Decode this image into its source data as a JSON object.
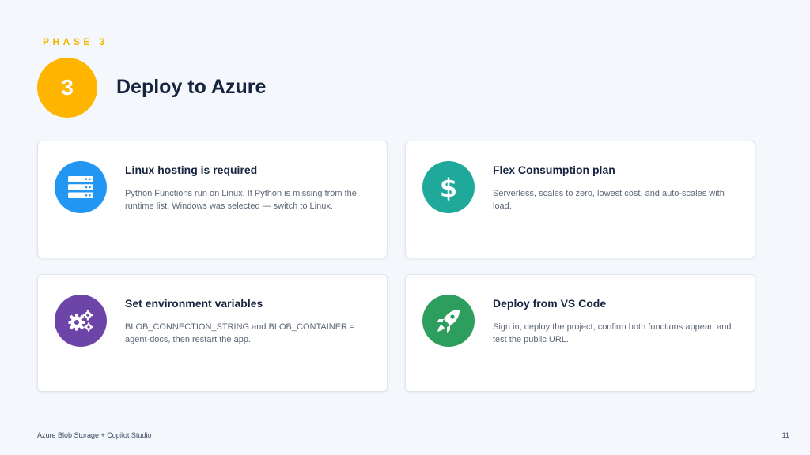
{
  "header": {
    "phase_label": "PHASE 3",
    "phase_number": "3",
    "title": "Deploy to Azure",
    "accent_color": "#ffb500"
  },
  "cards": [
    {
      "title": "Linux hosting is required",
      "description": "Python Functions run on Linux. If Python is missing from the runtime list, Windows was selected — switch to Linux.",
      "icon": "server-icon",
      "color": "#2196f3"
    },
    {
      "title": "Flex Consumption plan",
      "description": "Serverless, scales to zero, lowest cost, and auto-scales with load.",
      "icon": "dollar-icon",
      "color": "#1fa99a"
    },
    {
      "title": "Set environment variables",
      "description": "BLOB_CONNECTION_STRING and BLOB_CONTAINER = agent-docs, then restart the app.",
      "icon": "gears-icon",
      "color": "#6d45a8"
    },
    {
      "title": "Deploy from VS Code",
      "description": "Sign in, deploy the project, confirm both functions appear, and test the public URL.",
      "icon": "rocket-icon",
      "color": "#2e9e5e"
    }
  ],
  "footer": {
    "left": "Azure Blob Storage + Copilot Studio",
    "page_number": "11"
  }
}
